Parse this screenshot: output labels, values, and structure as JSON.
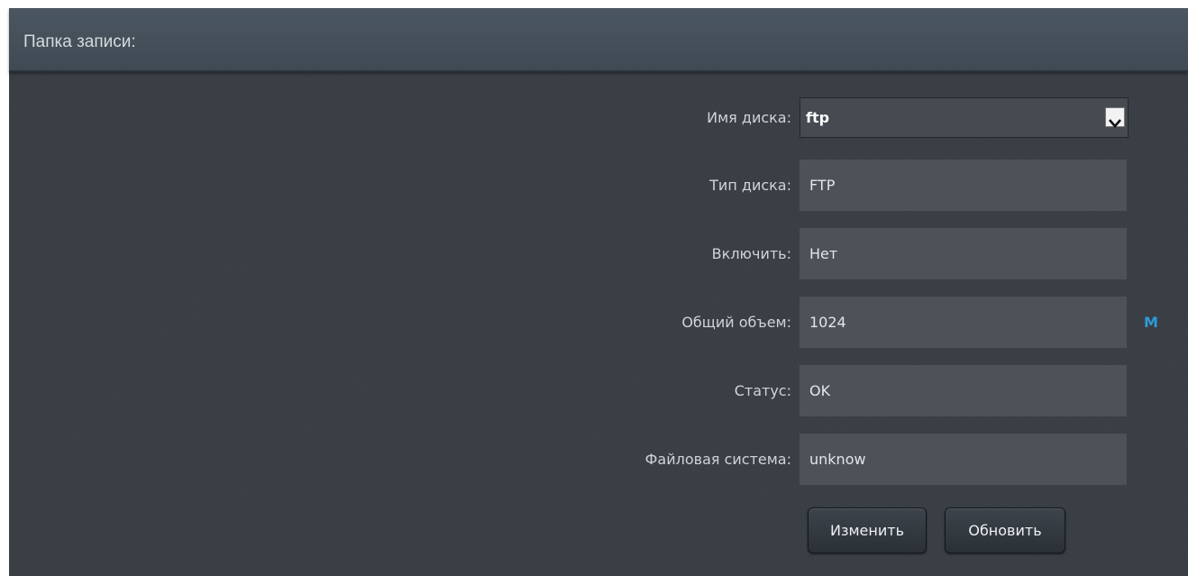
{
  "header": {
    "title": "Папка записи:"
  },
  "form": {
    "disk_name": {
      "label": "Имя диска:",
      "value": "ftp"
    },
    "disk_type": {
      "label": "Тип диска:",
      "value": "FTP"
    },
    "enable": {
      "label": "Включить:",
      "value": "Нет"
    },
    "total_size": {
      "label": "Общий объем:",
      "value": "1024",
      "unit": "M"
    },
    "status": {
      "label": "Статус:",
      "value": "OK"
    },
    "filesystem": {
      "label": "Файловая система:",
      "value": "unknow"
    }
  },
  "buttons": {
    "modify": "Изменить",
    "refresh": "Обновить"
  },
  "colors": {
    "panel_bg": "#3a3f45",
    "header_bg": "#46525c",
    "field_bg": "#4c5258",
    "unit_accent": "#2f9bd8"
  },
  "icons": {
    "dropdown": "chevron-down-icon"
  }
}
